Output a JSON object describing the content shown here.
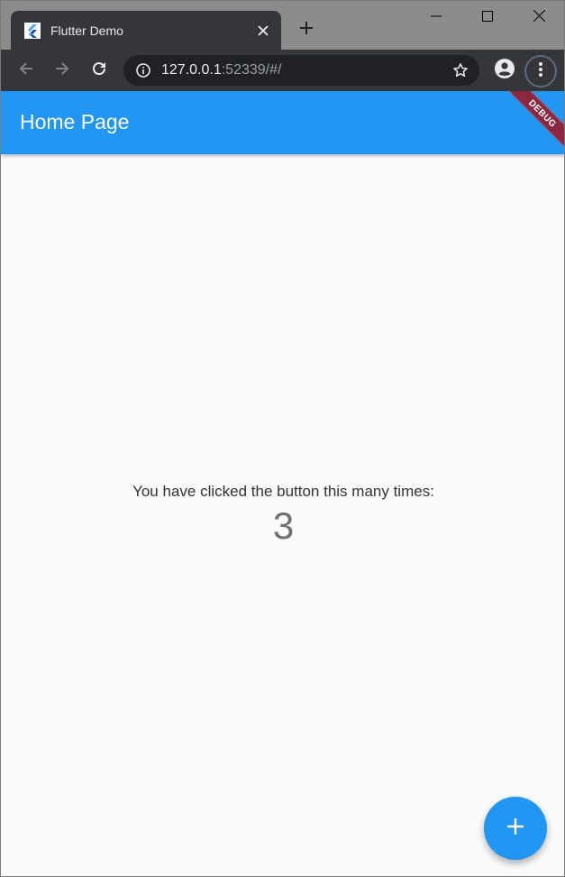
{
  "browser": {
    "tab_title": "Flutter Demo",
    "url_host": "127.0.0.1",
    "url_rest": ":52339/#/"
  },
  "icons": {
    "favicon": "flutter-logo-icon",
    "tab_close": "close-icon",
    "new_tab": "plus-icon",
    "minimize": "minimize-icon",
    "maximize": "maximize-icon",
    "window_close": "close-icon",
    "back": "arrow-left-icon",
    "forward": "arrow-right-icon",
    "reload": "reload-icon",
    "site_info": "info-icon",
    "bookmark": "star-icon",
    "profile": "account-icon",
    "menu": "more-vert-icon",
    "fab": "plus-icon"
  },
  "colors": {
    "primary": "#2196f3",
    "debug_banner": "#8b2741",
    "browser_chrome": "#35363a"
  },
  "app": {
    "title": "Home Page",
    "debug_label": "DEBUG",
    "counter_label": "You have clicked the button this many times:",
    "counter_value": "3"
  }
}
